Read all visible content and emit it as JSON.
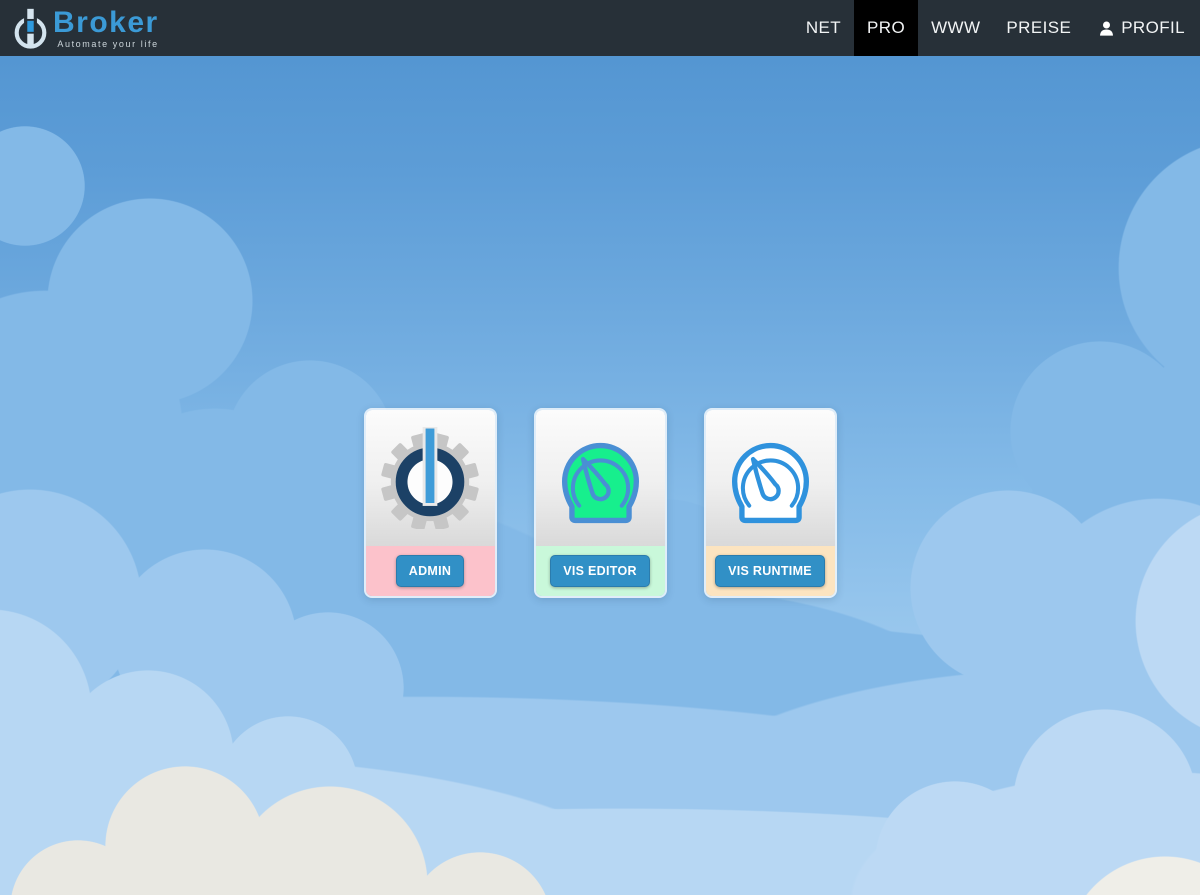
{
  "header": {
    "brand": "Broker",
    "tagline": "Automate your life",
    "nav_items": [
      {
        "label": "NET",
        "active": false
      },
      {
        "label": "PRO",
        "active": true
      },
      {
        "label": "WWW",
        "active": false
      },
      {
        "label": "PREISE",
        "active": false
      },
      {
        "label": "PROFIL",
        "active": false,
        "icon": "person-icon"
      }
    ]
  },
  "cards": [
    {
      "name": "admin",
      "button_label": "ADMIN",
      "accent_color": "#fcc2cb",
      "icon": "iobroker-admin-gear-icon"
    },
    {
      "name": "vis-editor",
      "button_label": "VIS EDITOR",
      "accent_color": "#c9f8da",
      "icon": "gauge-filled-green-icon"
    },
    {
      "name": "vis-runtime",
      "button_label": "VIS RUNTIME",
      "accent_color": "#fce4c0",
      "icon": "gauge-outline-blue-icon"
    }
  ],
  "colors": {
    "header_bg": "#273038",
    "active_tab_bg": "#000000",
    "brand_blue": "#3b9ad6",
    "button_blue": "#3190c6",
    "gauge_green": "#17ef8d",
    "icon_stroke_blue": "#3d91d8",
    "admin_ring_navy": "#1c4166",
    "admin_bar_blue": "#3f9cd8",
    "gear_gray": "#c6c6c6"
  }
}
